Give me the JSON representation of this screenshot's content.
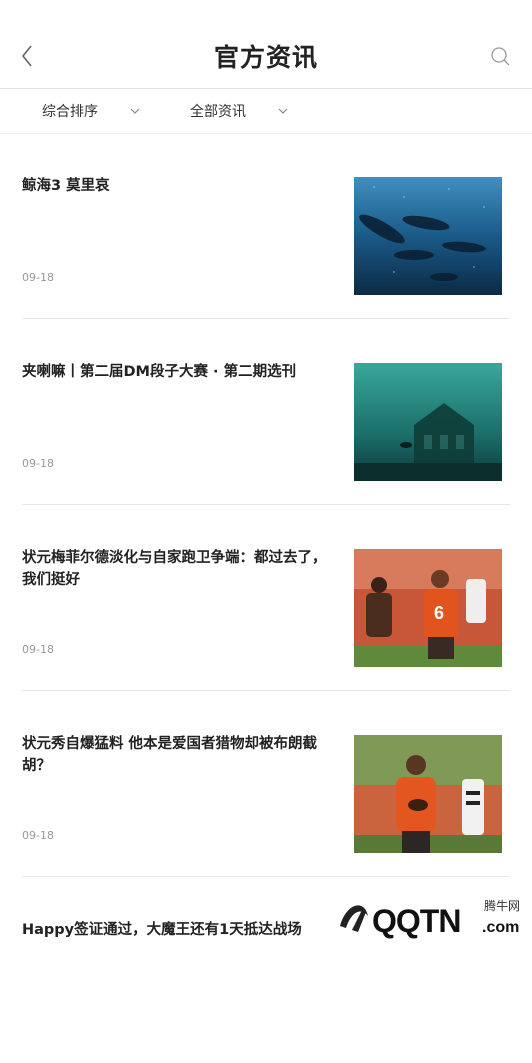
{
  "header": {
    "title": "官方资讯"
  },
  "filters": {
    "sort_label": "综合排序",
    "type_label": "全部资讯"
  },
  "articles": [
    {
      "title": "鲸海3 莫里哀",
      "date": "09-18",
      "image": "whales-underwater"
    },
    {
      "title": "夹喇嘛丨第二届DM段子大赛 · 第二期选刊",
      "date": "09-18",
      "image": "sunken-ruins"
    },
    {
      "title": "状元梅菲尔德淡化与自家跑卫争端：都过去了，我们挺好",
      "date": "09-18",
      "image": "football-players"
    },
    {
      "title": "状元秀自爆猛料 他本是爱国者猎物却被布朗截胡？",
      "date": "09-18",
      "image": "football-quarterback"
    },
    {
      "title": "Happy签证通过，大魔王还有1天抵达战场",
      "date": "",
      "image": ""
    }
  ],
  "watermark": {
    "brand": "腾牛网",
    "logo_text": "QQTN",
    "suffix": ".com"
  },
  "colors": {
    "accent": "#222222",
    "divider": "#e6e6e6",
    "date": "#999999"
  }
}
